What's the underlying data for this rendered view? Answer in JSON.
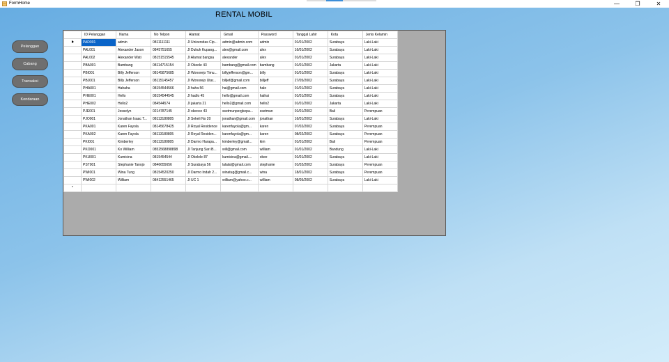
{
  "window": {
    "title": "FormHome",
    "min_glyph": "—",
    "max_glyph": "❐",
    "close_glyph": "✕"
  },
  "page_title": "RENTAL MOBIL",
  "nav": [
    {
      "label": "Pelanggan"
    },
    {
      "label": "Cabang"
    },
    {
      "label": "Transaksi"
    },
    {
      "label": "Kendaraan"
    }
  ],
  "grid": {
    "columns": [
      "ID Pelanggan",
      "Nama",
      "No Telpon",
      "Alamat",
      "Gmail",
      "Password",
      "Tanggal Lahir",
      "Kota",
      "Jenis Kelamin"
    ],
    "rows": [
      [
        "PAD001",
        "admin",
        "0811111111",
        "Jl Universitas Cip...",
        "admin@admin.com",
        "admin",
        "01/01/2002",
        "Surabaya",
        "Laki-Laki"
      ],
      [
        "PAL001",
        "Alexander Jason",
        "0845751655",
        "Jl Dukuh Kupang...",
        "alex@gmail.com",
        "alex",
        "16/01/2002",
        "Surabaya",
        "Laki-Laki"
      ],
      [
        "PAL002",
        "Alexander Wati",
        "08151515545",
        "Jl Alamat bangsa",
        "alexander",
        "alex",
        "01/01/2002",
        "Surabaya",
        "Laki-Laki"
      ],
      [
        "PBA001",
        "Bambang",
        "08114715154",
        "Jl Okeole 43",
        "bambang@gmail.com",
        "bambang",
        "01/01/2002",
        "Jakarta",
        "Laki-Laki"
      ],
      [
        "PBI001",
        "Billy Jefferson",
        "08145875685",
        "Jl Wonorejo Timu...",
        "billyjefferson@gm...",
        "billy",
        "01/01/2002",
        "Surabaya",
        "Laki-Laki"
      ],
      [
        "PBJ001",
        "Billy Jefferson",
        "08115145457",
        "Jl Wonorejo Utar...",
        "billjef@gmail.com",
        "billjeff",
        "27/05/2002",
        "Surabaya",
        "Laki-Laki"
      ],
      [
        "PHA001",
        "Hahaha",
        "08154544566",
        "Jl haha 56",
        "hai@gmail.com",
        "halo",
        "01/01/2002",
        "Surabaya",
        "Laki-Laki"
      ],
      [
        "PHE001",
        "Hello",
        "08154544545",
        "Jl hadlo 45",
        "hello@gmail.com",
        "haihai",
        "01/01/2002",
        "Surabaya",
        "Laki-Laki"
      ],
      [
        "PHE002",
        "Hello2",
        "084544574",
        "Jl jakarta 21",
        "hello2@gmail.com",
        "hello2",
        "01/01/2002",
        "Jakarta",
        "Laki-Laki"
      ],
      [
        "PJE001",
        "Jesselyn",
        "0214787145",
        "Jl okeoce 43",
        "ssetmunpergkepa...",
        "ssetmun",
        "01/01/2002",
        "Bali",
        "Perempuan"
      ],
      [
        "PJO001",
        "Jonathan Isaac T...",
        "08113180805",
        "Jl Sekeli No 20",
        "jonathan@gmail.com",
        "jonathan",
        "16/01/2002",
        "Surabaya",
        "Laki-Laki"
      ],
      [
        "PKA001",
        "Karen Fayola",
        "08145678425",
        "Jl Royal Residence",
        "karenfayola@gm...",
        "karen",
        "07/02/2002",
        "Surabaya",
        "Perempuan"
      ],
      [
        "PKA002",
        "Karen Fayola",
        "08113180805",
        "Jl Royal Residen...",
        "karenfayola@gm...",
        "karen",
        "08/02/2002",
        "Surabaya",
        "Perempuan"
      ],
      [
        "PKI001",
        "Kimberley",
        "08113180805",
        "Jl Darmo Harapa...",
        "kimberley@gmail...",
        "kim",
        "01/01/2002",
        "Bali",
        "Perempuan"
      ],
      [
        "PKO001",
        "Ko William",
        "0852568898898",
        "Jl Tanjung Sari B...",
        "will@gmail.com",
        "william",
        "01/01/2002",
        "Bandung",
        "Laki-Laki"
      ],
      [
        "PKU001",
        "Kumicina",
        "0815454544",
        "Jl Okelele 87",
        "kumicina@gmail....",
        "okee",
        "01/01/2002",
        "Surabaya",
        "Laki-Laki"
      ],
      [
        "PST001",
        "Stephanie Tanojo",
        "0846655656",
        "Jl Surabaya 56",
        "lalalal@gmail.com",
        "stephanie",
        "01/02/2002",
        "Surabaya",
        "Perempuan"
      ],
      [
        "PWI001",
        "Wina Tung",
        "08154520250",
        "Jl Darmo Indah 2...",
        "winatug@gmail.c...",
        "wina",
        "18/01/2002",
        "Surabaya",
        "Perempuan"
      ],
      [
        "PWI002",
        "William",
        "08412551465",
        "Jl UC 1",
        "william@yahoo.c...",
        "william",
        "08/05/2002",
        "Surabaya",
        "Laki-Laki"
      ]
    ],
    "new_row_marker": "*"
  }
}
